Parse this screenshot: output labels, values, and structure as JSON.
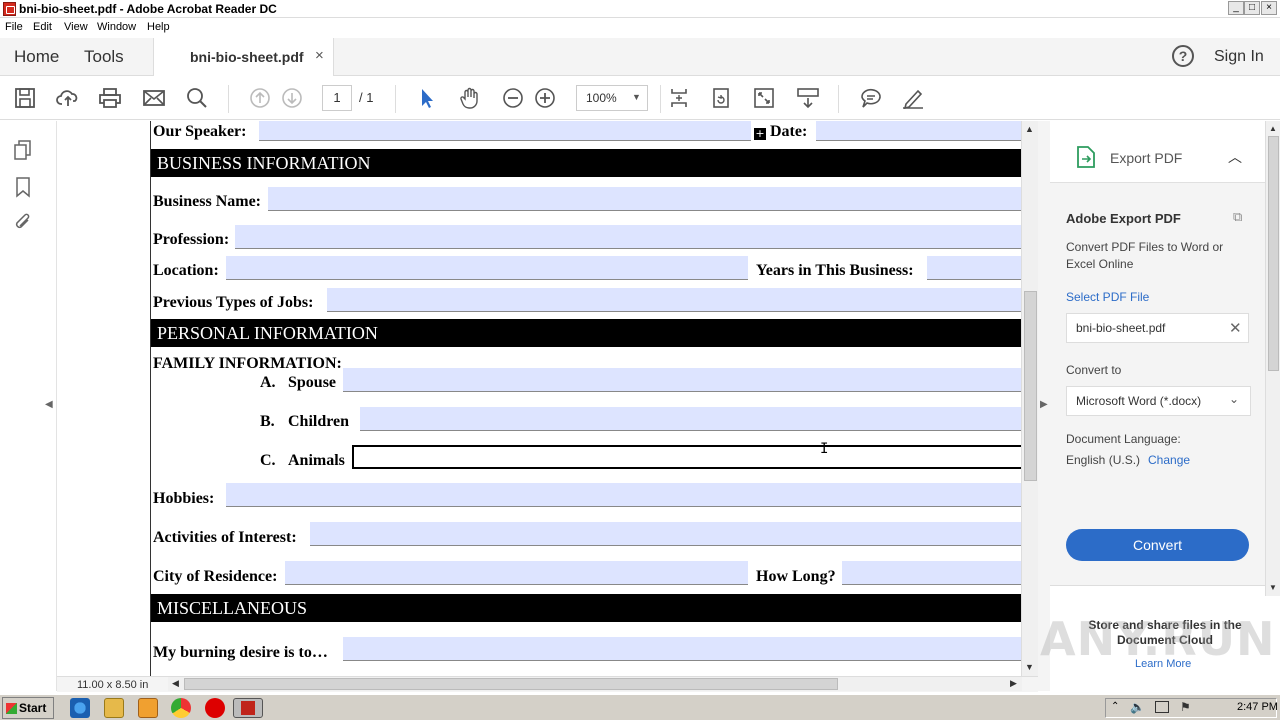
{
  "window": {
    "title": "bni-bio-sheet.pdf - Adobe Acrobat Reader DC",
    "controls": [
      "_",
      "□",
      "×"
    ]
  },
  "menu": [
    "File",
    "Edit",
    "View",
    "Window",
    "Help"
  ],
  "nav": {
    "home": "Home",
    "tools": "Tools",
    "doc_tab": "bni-bio-sheet.pdf",
    "help": "?",
    "sign_in": "Sign In"
  },
  "toolbar": {
    "page_current": "1",
    "page_total": "/ 1",
    "zoom": "100%",
    "icons": [
      "save-icon",
      "upload-icon",
      "print-icon",
      "mail-icon",
      "search-icon",
      "prev-page-icon",
      "next-page-icon",
      "select-cursor-icon",
      "hand-icon",
      "zoom-out-icon",
      "zoom-in-icon",
      "fit-page-icon",
      "rotate-icon",
      "full-screen-icon",
      "scroll-mode-icon",
      "comment-icon",
      "sign-icon"
    ]
  },
  "document": {
    "our_speaker": "Our Speaker:",
    "date": "Date:",
    "sections": {
      "business": "BUSINESS INFORMATION",
      "personal": "PERSONAL INFORMATION",
      "misc": "MISCELLANEOUS"
    },
    "fields": {
      "business_name": "Business Name:",
      "profession": "Profession:",
      "location": "Location:",
      "years": "Years in This Business:",
      "previous_jobs": "Previous Types of Jobs:",
      "family": "FAMILY INFORMATION:",
      "spouse_letter": "A.",
      "spouse": "Spouse",
      "children_letter": "B.",
      "children": "Children",
      "animals_letter": "C.",
      "animals": "Animals",
      "hobbies": "Hobbies:",
      "activities": "Activities of Interest:",
      "city": "City of Residence:",
      "how_long": "How Long?",
      "burning_desire": "My burning desire is to…"
    },
    "page_size": "11.00 x 8.50 in"
  },
  "right_panel": {
    "header": "Export PDF",
    "title": "Adobe Export PDF",
    "description": "Convert PDF Files to Word or Excel Online",
    "select_file": "Select PDF File",
    "file_name": "bni-bio-sheet.pdf",
    "convert_to_label": "Convert to",
    "convert_to_value": "Microsoft Word (*.docx)",
    "doc_language_label": "Document Language:",
    "doc_language_value": "English (U.S.)",
    "change": "Change",
    "convert_button": "Convert",
    "store_text": "Store and share files in the Document Cloud",
    "learn_more": "Learn More"
  },
  "watermark": "ANY.RUN",
  "taskbar": {
    "start": "Start",
    "clock": "2:47 PM"
  },
  "colors": {
    "field_fill": "#dde4ff",
    "section_bg": "#000000",
    "accent_blue": "#2c6cc8",
    "export_green": "#2d9c5e"
  }
}
